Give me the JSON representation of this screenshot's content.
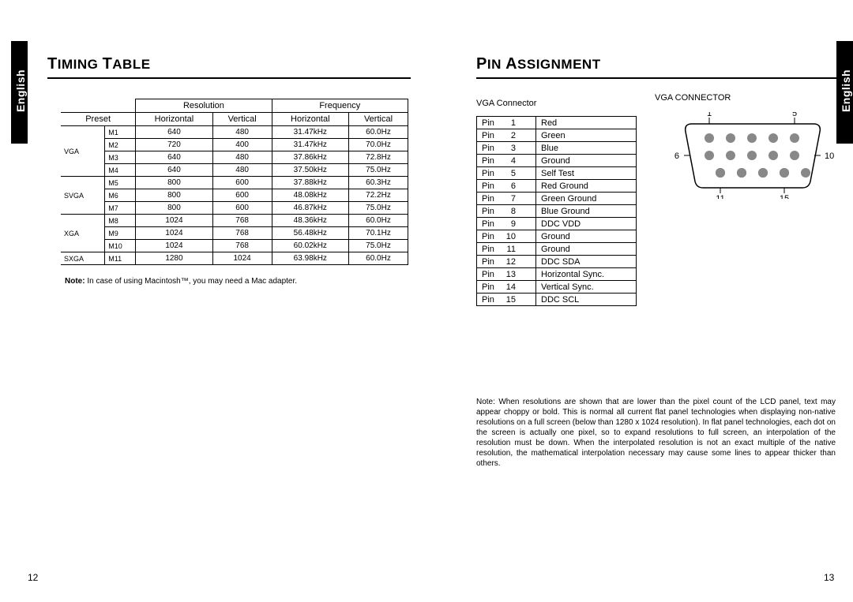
{
  "tabs": {
    "left": "English",
    "right": "English"
  },
  "left_page": {
    "title": "TIMING TABLE",
    "cols": {
      "preset": "Preset",
      "resolution": "Resolution",
      "frequency": "Frequency",
      "horizontal": "Horizontal",
      "vertical": "Vertical"
    },
    "groups": [
      {
        "mode": "VGA",
        "rows": [
          {
            "p": "M1",
            "h": "640",
            "v": "480",
            "fh": "31.47kHz",
            "fv": "60.0Hz"
          },
          {
            "p": "M2",
            "h": "720",
            "v": "400",
            "fh": "31.47kHz",
            "fv": "70.0Hz"
          },
          {
            "p": "M3",
            "h": "640",
            "v": "480",
            "fh": "37.86kHz",
            "fv": "72.8Hz"
          },
          {
            "p": "M4",
            "h": "640",
            "v": "480",
            "fh": "37.50kHz",
            "fv": "75.0Hz"
          }
        ]
      },
      {
        "mode": "SVGA",
        "rows": [
          {
            "p": "M5",
            "h": "800",
            "v": "600",
            "fh": "37.88kHz",
            "fv": "60.3Hz"
          },
          {
            "p": "M6",
            "h": "800",
            "v": "600",
            "fh": "48.08kHz",
            "fv": "72.2Hz"
          },
          {
            "p": "M7",
            "h": "800",
            "v": "600",
            "fh": "46.87kHz",
            "fv": "75.0Hz"
          }
        ]
      },
      {
        "mode": "XGA",
        "rows": [
          {
            "p": "M8",
            "h": "1024",
            "v": "768",
            "fh": "48.36kHz",
            "fv": "60.0Hz"
          },
          {
            "p": "M9",
            "h": "1024",
            "v": "768",
            "fh": "56.48kHz",
            "fv": "70.1Hz"
          },
          {
            "p": "M10",
            "h": "1024",
            "v": "768",
            "fh": "60.02kHz",
            "fv": "75.0Hz"
          }
        ]
      },
      {
        "mode": "SXGA",
        "rows": [
          {
            "p": "M11",
            "h": "1280",
            "v": "1024",
            "fh": "63.98kHz",
            "fv": "60.0Hz"
          }
        ]
      }
    ],
    "note_label": "Note:",
    "note": "In case of using Macintosh™, you may need a Mac adapter.",
    "page_num": "12"
  },
  "right_page": {
    "title": "PIN ASSIGNMENT",
    "vga_label": "VGA Connector",
    "diagram_label": "VGA CONNECTOR",
    "pin_word": "Pin",
    "pins": [
      {
        "n": "1",
        "d": "Red"
      },
      {
        "n": "2",
        "d": "Green"
      },
      {
        "n": "3",
        "d": "Blue"
      },
      {
        "n": "4",
        "d": "Ground"
      },
      {
        "n": "5",
        "d": "Self Test"
      },
      {
        "n": "6",
        "d": "Red Ground"
      },
      {
        "n": "7",
        "d": "Green Ground"
      },
      {
        "n": "8",
        "d": "Blue Ground"
      },
      {
        "n": "9",
        "d": "DDC VDD"
      },
      {
        "n": "10",
        "d": "Ground"
      },
      {
        "n": "11",
        "d": "Ground"
      },
      {
        "n": "12",
        "d": "DDC SDA"
      },
      {
        "n": "13",
        "d": "Horizontal Sync."
      },
      {
        "n": "14",
        "d": "Vertical Sync."
      },
      {
        "n": "15",
        "d": "DDC SCL"
      }
    ],
    "diagram_pins": {
      "tl": "1",
      "tr": "5",
      "ml": "6",
      "mr": "10",
      "bl": "11",
      "br": "15"
    },
    "note": "Note: When resolutions are shown that are lower than the pixel count of the LCD panel, text may appear choppy or bold. This is normal all current flat panel technologies when displaying non-native resolutions on a full screen (below than 1280 x 1024 resolution). In flat panel technologies, each dot on the screen is actually one pixel, so to expand resolutions to full screen, an interpolation of the resolution must be down. When the interpolated resolution is not an exact multiple of the native resolution, the mathematical interpolation necessary may cause some lines to appear thicker than others.",
    "page_num": "13"
  }
}
